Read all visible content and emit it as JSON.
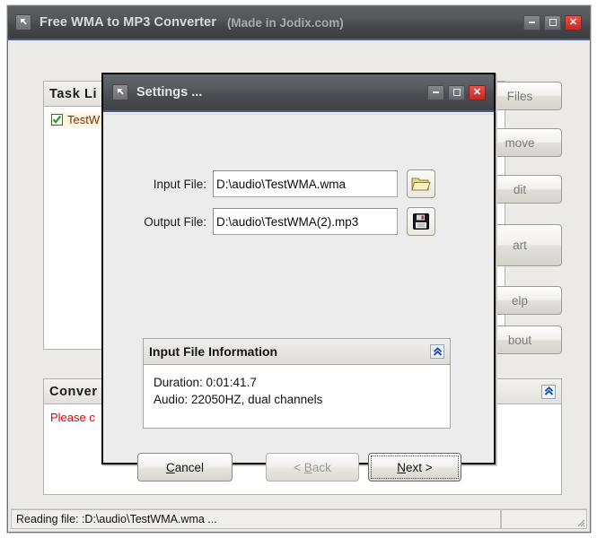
{
  "main_window": {
    "title": "Free WMA to MP3 Converter",
    "subtitle": "(Made in Jodix.com)",
    "icon": "app-arrow-icon",
    "window_controls": {
      "minimize": "minimize-icon",
      "maximize": "maximize-icon",
      "close": "close-icon"
    },
    "task_list": {
      "header": "Task Li",
      "header_full": "Task List",
      "items": [
        {
          "label": "TestW",
          "checked": true
        }
      ]
    },
    "conversion_panel": {
      "header": "Conver",
      "header_full": "Conversion",
      "message": "Please c",
      "collapse_icon": "chevron-double-up-icon"
    },
    "side_buttons": [
      {
        "label": "Files",
        "full": "Add Files",
        "enabled": false
      },
      {
        "label": "move",
        "full": "Remove",
        "enabled": false
      },
      {
        "label": "dit",
        "full": "Edit",
        "enabled": false
      },
      {
        "label": "art",
        "full": "Start",
        "enabled": false
      },
      {
        "label": "elp",
        "full": "Help",
        "enabled": false
      },
      {
        "label": "bout",
        "full": "About",
        "enabled": false
      }
    ],
    "status_bar": {
      "message": "Reading file: :D:\\audio\\TestWMA.wma ...",
      "secondary": ""
    }
  },
  "dialog": {
    "title": "Settings ...",
    "icon": "app-arrow-icon",
    "window_controls": {
      "minimize": "minimize-icon",
      "maximize": "maximize-icon",
      "close": "close-icon"
    },
    "fields": {
      "input_label": "Input File:",
      "input_value": "D:\\audio\\TestWMA.wma",
      "input_browse_icon": "folder-open-icon",
      "output_label": "Output File:",
      "output_value": "D:\\audio\\TestWMA(2).mp3",
      "output_browse_icon": "floppy-save-icon"
    },
    "info_group": {
      "header": "Input File Information",
      "collapse_icon": "chevron-double-up-icon",
      "lines": [
        "Duration: 0:01:41.7",
        "Audio: 22050HZ, dual channels"
      ]
    },
    "buttons": {
      "cancel": "Cancel",
      "cancel_accel": "C",
      "back": "< Back",
      "back_accel": "B",
      "back_enabled": false,
      "next": "Next >",
      "next_accel": "N",
      "next_default": true
    }
  },
  "colors": {
    "titlebar_dark": "#4b4e52",
    "titlebar_accent": "#4b5d86",
    "close_red": "#c22a23",
    "window_bg": "#eceae6",
    "dialog_bg": "#ececec",
    "task_text": "#8a2a12",
    "task_highlight": "#fdf7dd",
    "conversion_text": "#e30000",
    "collapse_blue": "#1d4f9e",
    "folder_yellow": "#e8df8c"
  }
}
